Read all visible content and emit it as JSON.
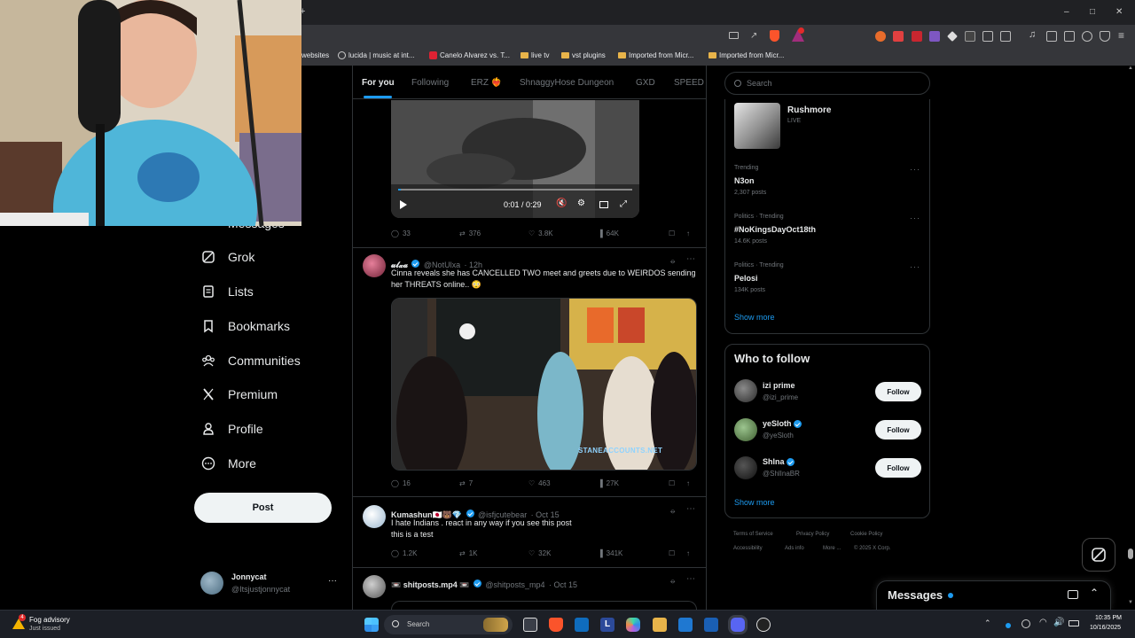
{
  "browser": {
    "new_tab_glyph": "+",
    "bookmarks": [
      {
        "label": "websites",
        "icon": "none"
      },
      {
        "label": "lucida | music at int...",
        "icon": "site-icon"
      },
      {
        "label": "Canelo Alvarez vs. T...",
        "icon": "site-icon"
      },
      {
        "label": "live tv",
        "icon": "folder-icon"
      },
      {
        "label": "vst plugins",
        "icon": "folder-icon"
      },
      {
        "label": "Imported from Micr...",
        "icon": "folder-icon"
      },
      {
        "label": "Imported from Micr...",
        "icon": "folder-icon"
      }
    ]
  },
  "nav": {
    "partial_label": "Messages",
    "items": [
      {
        "label": "Grok",
        "icon": "grok-icon"
      },
      {
        "label": "Lists",
        "icon": "lists-icon"
      },
      {
        "label": "Bookmarks",
        "icon": "bookmark-icon"
      },
      {
        "label": "Communities",
        "icon": "communities-icon"
      },
      {
        "label": "Premium",
        "icon": "x-logo-icon"
      },
      {
        "label": "Profile",
        "icon": "profile-icon"
      },
      {
        "label": "More",
        "icon": "more-circle-icon"
      }
    ],
    "post_label": "Post",
    "account": {
      "name": "Jonnycat",
      "handle": "@Itsjustjonnycat",
      "menu": "···"
    }
  },
  "feed": {
    "tabs": [
      "For you",
      "Following",
      "ERZ ❤️‍🔥",
      "ShnaggyHose Dungeon",
      "GXD",
      "SPEED"
    ],
    "active_tab": "For you",
    "video": {
      "time": "0:01 / 0:29"
    },
    "posts": [
      {
        "replies": "33",
        "reposts": "376",
        "likes": "3.8K",
        "views": "64K"
      },
      {
        "name": "𝓾𝓵𝔁𝓪",
        "handle": "@NotUlxa",
        "time": "· 12h",
        "verified": true,
        "text": "Cinna reveals she has CANCELLED TWO meet and greets due to WEIRDOS sending her THREATS online.. 😳",
        "watermark": "STANEACCOUNTS.NET",
        "replies": "16",
        "reposts": "7",
        "likes": "463",
        "views": "27K"
      },
      {
        "name": "Kumashun🇯🇵🐻💎",
        "handle": "@isfjcutebear",
        "time": "· Oct 15",
        "verified": true,
        "text_line1": "I hate Indians . react in any way if you see this post",
        "text_line2": "this is a test",
        "replies": "1.2K",
        "reposts": "1K",
        "likes": "32K",
        "views": "341K"
      },
      {
        "name": "📼 shitposts.mp4 📼",
        "handle": "@shitposts_mp4",
        "time": "· Oct 15",
        "verified": true
      }
    ]
  },
  "sidebar": {
    "search_placeholder": "Search",
    "live": {
      "name": "Rushmore",
      "status": "LIVE"
    },
    "trends": [
      {
        "meta": "Trending",
        "name": "N3on",
        "count": "2,307 posts"
      },
      {
        "meta": "Politics · Trending",
        "name": "#NoKingsDayOct18th",
        "count": "14.6K posts"
      },
      {
        "meta": "Politics · Trending",
        "name": "Pelosi",
        "count": "134K posts"
      }
    ],
    "show_more": "Show more",
    "who_to_follow": {
      "title": "Who to follow",
      "users": [
        {
          "name": "izi prime",
          "handle": "@izi_prime",
          "verified": false
        },
        {
          "name": "yeSloth",
          "handle": "@yeSloth",
          "verified": true
        },
        {
          "name": "Shlna",
          "handle": "@ShlInaBR",
          "verified": true
        }
      ],
      "follow_label": "Follow",
      "show_more": "Show more"
    },
    "footer": [
      "Terms of Service",
      "Privacy Policy",
      "Cookie Policy",
      "Accessibility",
      "Ads info",
      "More ...",
      "© 2025 X Corp."
    ],
    "messages_label": "Messages"
  },
  "taskbar": {
    "weather_title": "Fog advisory",
    "weather_sub": "Just issued",
    "weather_badge": "4",
    "search_label": "Search",
    "time": "10:35 PM",
    "date": "10/16/2025"
  },
  "colors": {
    "accent": "#1d9bf0",
    "background": "#000000",
    "border": "#2f3336"
  }
}
